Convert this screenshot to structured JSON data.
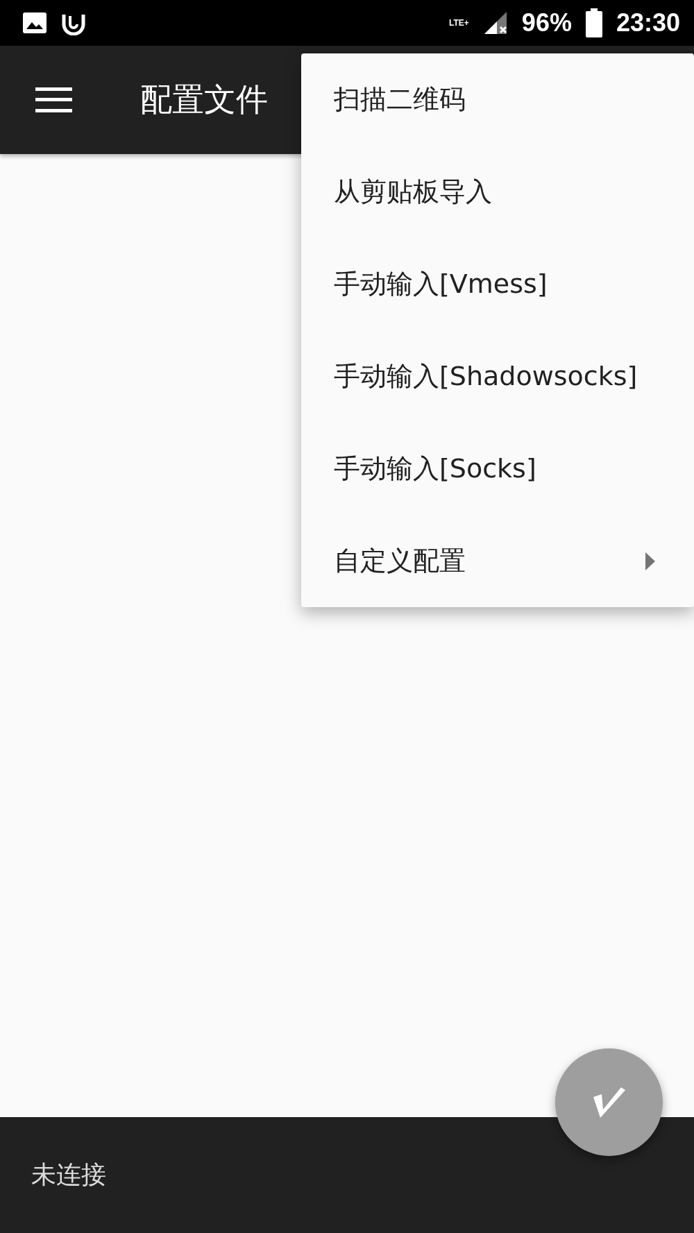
{
  "status_bar": {
    "network": "LTE+",
    "battery": "96%",
    "time": "23:30"
  },
  "toolbar": {
    "title": "配置文件"
  },
  "menu": [
    {
      "label": "扫描二维码",
      "submenu": false
    },
    {
      "label": "从剪贴板导入",
      "submenu": false
    },
    {
      "label": "手动输入[Vmess]",
      "submenu": false
    },
    {
      "label": "手动输入[Shadowsocks]",
      "submenu": false
    },
    {
      "label": "手动输入[Socks]",
      "submenu": false
    },
    {
      "label": "自定义配置",
      "submenu": true
    }
  ],
  "bottom_bar": {
    "status": "未连接"
  }
}
